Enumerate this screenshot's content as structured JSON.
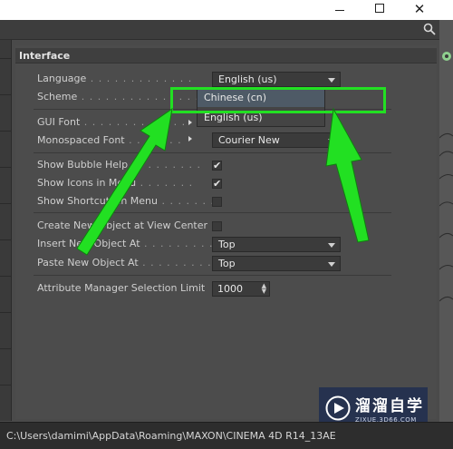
{
  "window": {
    "controls": {
      "minimize": "",
      "maximize": "",
      "close": "✕"
    }
  },
  "panel": {
    "title": "Interface",
    "settings": [
      {
        "label": "Language",
        "dots": " . . . . . . . . . . . . .",
        "control": "dropdown",
        "value": "English (us)"
      },
      {
        "label": "Scheme",
        "dots": " . . . . . . . . . . . . . . .",
        "control": "dropdown",
        "value": ""
      },
      {
        "label": "GUI Font",
        "dots": " . . . . . . . . . . . . .",
        "control": "font",
        "value": ""
      },
      {
        "label": "Monospaced Font",
        "dots": " . . . . . . .",
        "control": "font",
        "value": "Courier New"
      },
      {
        "label": "Show Bubble Help",
        "dots": " . . . . . . . . .",
        "control": "checkbox",
        "checked": true
      },
      {
        "label": "Show Icons in Menu",
        "dots": " . . . . . . .",
        "control": "checkbox",
        "checked": true
      },
      {
        "label": "Show Shortcuts in Menu",
        "dots": " . . . . . . .",
        "control": "checkbox",
        "checked": false
      },
      {
        "label": "Create New Object at View Center",
        "dots": "",
        "control": "checkbox",
        "checked": false
      },
      {
        "label": "Insert New Object At",
        "dots": " . . . . . . . . . . .",
        "control": "dropdown",
        "value": "Top"
      },
      {
        "label": "Paste New Object At",
        "dots": " . . . . . . . . . . .",
        "control": "dropdown",
        "value": "Top"
      },
      {
        "label": "Attribute Manager Selection Limit",
        "dots": "",
        "control": "number",
        "value": "1000"
      }
    ],
    "language_popup": {
      "options": [
        {
          "label": "Chinese (cn)",
          "selected": true
        },
        {
          "label": "English (us)",
          "selected": false
        }
      ]
    }
  },
  "statusbar": {
    "path": "C:\\Users\\damimi\\AppData\\Roaming\\MAXON\\CINEMA 4D R14_13AE"
  },
  "watermark": {
    "title": "溜溜自学",
    "subtitle": "ZIXUE.3D66.COM"
  },
  "annotation": {
    "color": "#22e022"
  },
  "icons": {
    "search": "search-icon",
    "checkmark": "checkmark-icon",
    "dropdown_arrow": "chevron-down-icon",
    "submenu": "submenu-arrow-icon"
  }
}
